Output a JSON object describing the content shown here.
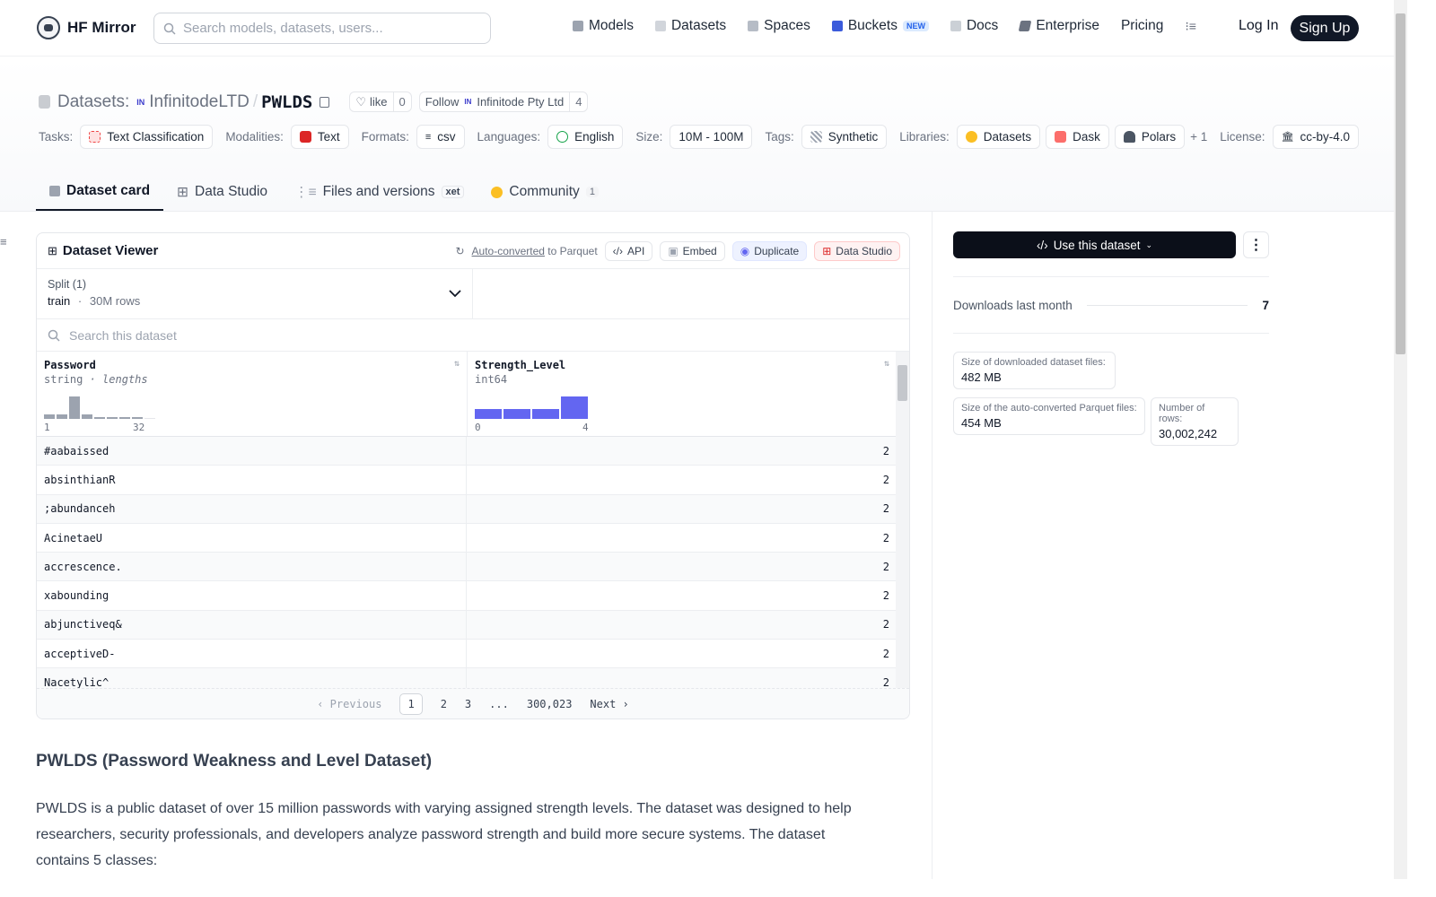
{
  "nav": {
    "brand": "HF Mirror",
    "search_placeholder": "Search models, datasets, users...",
    "items": [
      {
        "label": "Models",
        "icon": "cube-icon"
      },
      {
        "label": "Datasets",
        "icon": "database-icon"
      },
      {
        "label": "Spaces",
        "icon": "grid-icon"
      },
      {
        "label": "Buckets",
        "icon": "bucket-icon",
        "badge": "NEW"
      },
      {
        "label": "Docs",
        "icon": "book-icon"
      },
      {
        "label": "Enterprise",
        "icon": "enterprise-icon"
      },
      {
        "label": "Pricing"
      }
    ],
    "login": "Log In",
    "signup": "Sign Up"
  },
  "repo": {
    "kind": "Datasets:",
    "owner": "InfinitodeLTD",
    "separator": "/",
    "name": "PWLDS",
    "like_label": "like",
    "like_count": "0",
    "follow_label": "Follow",
    "follow_org": "Infinitode Pty Ltd",
    "follow_count": "4"
  },
  "tags": {
    "tasks_label": "Tasks:",
    "task": "Text Classification",
    "modalities_label": "Modalities:",
    "modality": "Text",
    "formats_label": "Formats:",
    "format": "csv",
    "languages_label": "Languages:",
    "language": "English",
    "size_label": "Size:",
    "size": "10M - 100M",
    "tags_label": "Tags:",
    "tag": "Synthetic",
    "libraries_label": "Libraries:",
    "lib1": "Datasets",
    "lib2": "Dask",
    "lib3": "Polars",
    "lib_more": "+ 1",
    "license_label": "License:",
    "license": "cc-by-4.0"
  },
  "tabs": {
    "card": "Dataset card",
    "studio": "Data Studio",
    "files": "Files and versions",
    "xet": "xet",
    "community": "Community",
    "community_count": "1"
  },
  "viewer": {
    "title": "Dataset Viewer",
    "auto": "Auto-converted",
    "to_parquet": "to Parquet",
    "api": "API",
    "embed": "Embed",
    "duplicate": "Duplicate",
    "data_studio": "Data Studio",
    "split_label": "Split (1)",
    "split_name": "train",
    "split_dot": "·",
    "split_rows": "30M rows",
    "search_placeholder": "Search this dataset",
    "col1": {
      "name": "Password",
      "type": "string",
      "extra": "· lengths",
      "min": "1",
      "max": "32"
    },
    "col2": {
      "name": "Strength_Level",
      "type": "int64",
      "min": "0",
      "max": "4"
    },
    "rows": [
      {
        "password": "#aabaissed",
        "level": "2"
      },
      {
        "password": "absinthianR",
        "level": "2"
      },
      {
        "password": ";abundanceh",
        "level": "2"
      },
      {
        "password": "AcinetaeU",
        "level": "2"
      },
      {
        "password": "accrescence.",
        "level": "2"
      },
      {
        "password": "xabounding",
        "level": "2"
      },
      {
        "password": "abjunctiveq&",
        "level": "2"
      },
      {
        "password": "acceptiveD-",
        "level": "2"
      },
      {
        "password": "Nacetylic^",
        "level": "2"
      }
    ],
    "pager": {
      "prev": "Previous",
      "p1": "1",
      "p2": "2",
      "p3": "3",
      "dots": "...",
      "last": "300,023",
      "next": "Next"
    }
  },
  "sidebar": {
    "use": "Use this dataset",
    "downloads_label": "Downloads last month",
    "downloads": "7",
    "size_dl_label": "Size of downloaded dataset files:",
    "size_dl": "482 MB",
    "size_pq_label": "Size of the auto-converted Parquet files:",
    "size_pq": "454 MB",
    "rows_label": "Number of rows:",
    "rows": "30,002,242"
  },
  "card": {
    "heading": "PWLDS (Password Weakness and Level Dataset)",
    "para": "PWLDS is a public dataset of over 15 million passwords with varying assigned strength levels. The dataset was designed to help researchers, security professionals, and developers analyze password strength and build more secure systems. The dataset contains 5 classes:"
  }
}
